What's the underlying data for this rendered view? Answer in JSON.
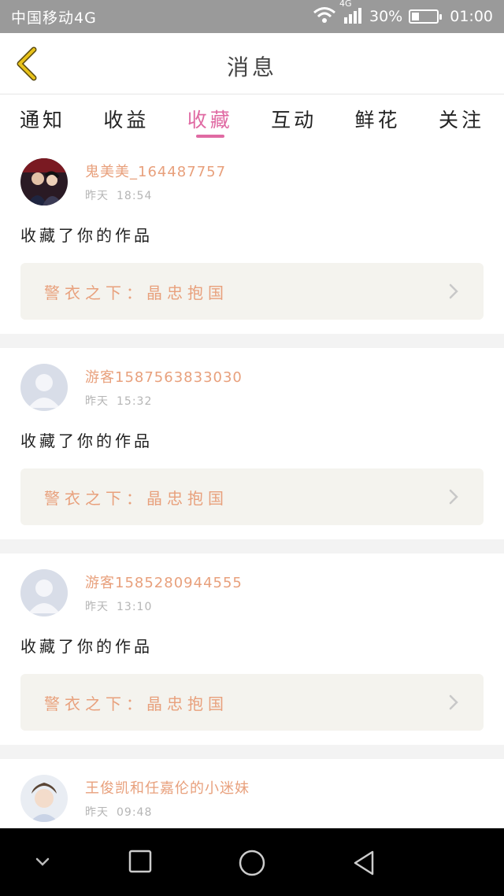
{
  "status_bar": {
    "carrier": "中国移动4G",
    "network": "4G",
    "battery": "30%",
    "battery_level": 0.3,
    "time": "01:00"
  },
  "header": {
    "title": "消息"
  },
  "tabs": [
    {
      "label": "通知",
      "active": false
    },
    {
      "label": "收益",
      "active": false
    },
    {
      "label": "收藏",
      "active": true
    },
    {
      "label": "互动",
      "active": false
    },
    {
      "label": "鲜花",
      "active": false
    },
    {
      "label": "关注",
      "active": false
    }
  ],
  "messages": [
    {
      "username": "鬼美美_164487757",
      "day": "昨天",
      "time": "18:54",
      "action": "收藏了你的作品",
      "work_title": "警衣之下：晶忠抱国",
      "avatar": "photo-couple"
    },
    {
      "username": "游客1587563833030",
      "day": "昨天",
      "time": "15:32",
      "action": "收藏了你的作品",
      "work_title": "警衣之下：晶忠抱国",
      "avatar": "default-user"
    },
    {
      "username": "游客1585280944555",
      "day": "昨天",
      "time": "13:10",
      "action": "收藏了你的作品",
      "work_title": "警衣之下：晶忠抱国",
      "avatar": "default-user"
    },
    {
      "username": "王俊凯和任嘉伦的小迷妹",
      "day": "昨天",
      "time": "09:48",
      "action": "",
      "work_title": "",
      "avatar": "photo-boy"
    }
  ],
  "colors": {
    "accent": "#e06aa3",
    "username": "#e8a07c",
    "work_bg": "#f4f3ee",
    "status_bar": "#9a9a9a",
    "back_icon": "#e8c21a"
  }
}
